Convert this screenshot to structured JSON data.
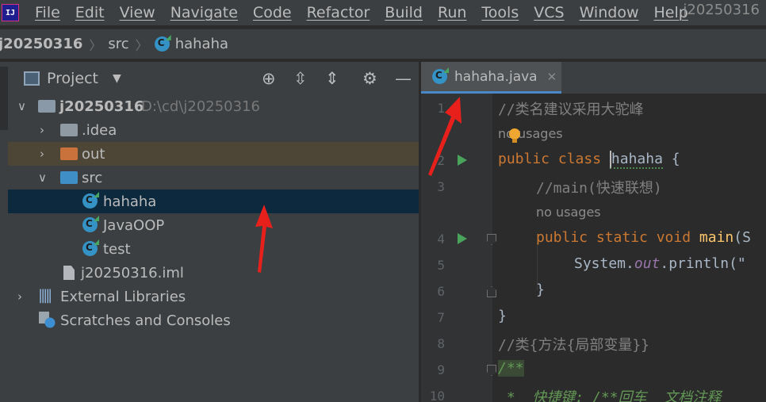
{
  "app": {
    "logo_text": "IJ",
    "project_title": "j20250316",
    "menus": [
      "File",
      "Edit",
      "View",
      "Navigate",
      "Code",
      "Refactor",
      "Build",
      "Run",
      "Tools",
      "VCS",
      "Window",
      "Help"
    ]
  },
  "breadcrumb": {
    "root": "j20250316",
    "folder": "src",
    "file": "hahaha"
  },
  "project_panel": {
    "title": "Project",
    "tree": {
      "root_name": "j20250316",
      "root_path": "D:\\cd\\j20250316",
      "idea": ".idea",
      "out": "out",
      "src": "src",
      "hahaha": "hahaha",
      "javaoop": "JavaOOP",
      "test": "test",
      "iml": "j20250316.iml",
      "ext_libs": "External Libraries",
      "scratches": "Scratches and Consoles"
    }
  },
  "editor": {
    "tab_name": "hahaha.java",
    "lines": {
      "n1": "1",
      "n2": "2",
      "n3": "3",
      "n4": "4",
      "n5": "5",
      "n6": "6",
      "n7": "7",
      "n8": "8",
      "n9": "9",
      "n10": "10"
    },
    "code": {
      "l1": "//类名建议采用大驼峰",
      "usages1": "no usages",
      "l2_kw": "public class",
      "l2_name": "hahaha",
      "l2_brace": " {",
      "l3": "//main(快速联想)",
      "usages2": "no usages",
      "l4_kw": "public static void",
      "l4_fn": "main",
      "l4_rest": "(S",
      "l5_a": "System.",
      "l5_out": "out",
      "l5_b": ".println(\"",
      "l6": "}",
      "l7": "}",
      "l8": "//类{方法{局部变量}}",
      "l9": "/**",
      "l10": " *  快捷键: /**回车  文档注释"
    }
  }
}
